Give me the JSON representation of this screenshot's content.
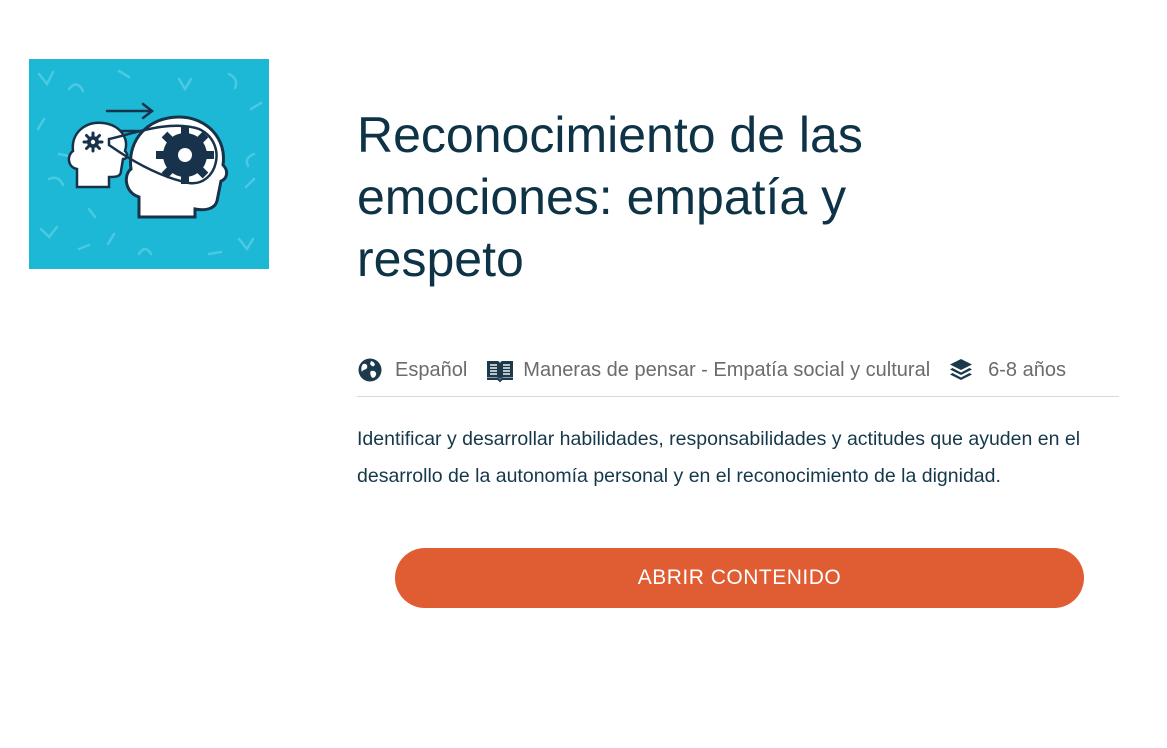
{
  "course": {
    "thumbnail_icon": "heads-gears-empathy-illustration",
    "title": "Reconocimiento de las emociones: empatía y respeto",
    "meta": {
      "language": {
        "icon": "globe-icon",
        "label": "Español"
      },
      "topic": {
        "icon": "book-icon",
        "label": "Maneras de pensar - Empatía social y cultural"
      },
      "age": {
        "icon": "layers-icon",
        "label": "6-8 años"
      }
    },
    "description": "Identificar y desarrollar habilidades, responsabilidades y actitudes que ayuden en el desarrollo de la autonomía personal y en el reconocimiento de la dignidad.",
    "cta_label": "ABRIR CONTENIDO"
  },
  "colors": {
    "title": "#0e3347",
    "thumbnail_bg": "#1db8d6",
    "cta_bg": "#e05c33",
    "meta_text": "#6b6b6b"
  }
}
